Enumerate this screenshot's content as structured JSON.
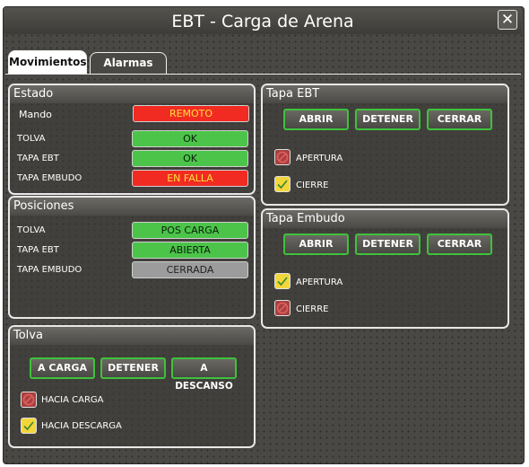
{
  "window": {
    "title": "EBT - Carga de Arena",
    "close_glyph": "✕"
  },
  "tabs": [
    {
      "label": "Movimientos",
      "active": true
    },
    {
      "label": "Alarmas",
      "active": false
    }
  ],
  "estado": {
    "title": "Estado",
    "rows": [
      {
        "label": "Mando",
        "value": "REMOTO",
        "status": "red"
      },
      {
        "label": "TOLVA",
        "value": "OK",
        "status": "green"
      },
      {
        "label": "TAPA EBT",
        "value": "OK",
        "status": "green"
      },
      {
        "label": "TAPA EMBUDO",
        "value": "EN FALLA",
        "status": "red"
      }
    ]
  },
  "posiciones": {
    "title": "Posiciones",
    "rows": [
      {
        "label": "TOLVA",
        "value": "POS CARGA",
        "status": "green"
      },
      {
        "label": "TAPA EBT",
        "value": "ABIERTA",
        "status": "green"
      },
      {
        "label": "TAPA EMBUDO",
        "value": "CERRADA",
        "status": "gray"
      }
    ]
  },
  "tolva": {
    "title": "Tolva",
    "buttons": [
      "A CARGA",
      "DETENER",
      "A DESCANSO"
    ],
    "checks": [
      {
        "label": "HACIA CARGA",
        "checked": false,
        "icon": "no-entry-icon"
      },
      {
        "label": "HACIA DESCARGA",
        "checked": true,
        "icon": "check-icon"
      }
    ]
  },
  "tapa_ebt": {
    "title": "Tapa EBT",
    "buttons": [
      "ABRIR",
      "DETENER",
      "CERRAR"
    ],
    "checks": [
      {
        "label": "APERTURA",
        "checked": false,
        "icon": "no-entry-icon"
      },
      {
        "label": "CIERRE",
        "checked": true,
        "icon": "check-icon"
      }
    ]
  },
  "tapa_embudo": {
    "title": "Tapa Embudo",
    "buttons": [
      "ABRIR",
      "DETENER",
      "CERRAR"
    ],
    "checks": [
      {
        "label": "APERTURA",
        "checked": true,
        "icon": "check-icon"
      },
      {
        "label": "CIERRE",
        "checked": false,
        "icon": "no-entry-icon"
      }
    ]
  },
  "colors": {
    "status_red": "#f22b22",
    "status_red_text": "#ffe03a",
    "status_green": "#4cc44a",
    "status_gray": "#9c9c9c",
    "button_border": "#3ec23c",
    "check_yellow": "#f3d63c"
  }
}
